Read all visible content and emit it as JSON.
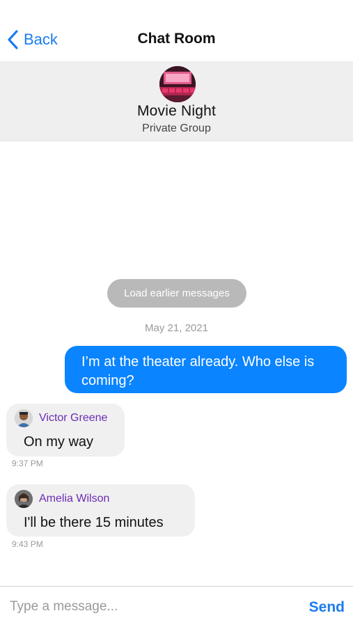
{
  "nav": {
    "back_label": "Back",
    "title": "Chat Room"
  },
  "group": {
    "name": "Movie Night",
    "subtitle": "Private Group",
    "avatar_icon": "movie-theater-avatar"
  },
  "load_earlier_label": "Load earlier messages",
  "date_label": "May 21, 2021",
  "messages": [
    {
      "direction": "outgoing",
      "text": "I’m at the theater already. Who else is coming?"
    },
    {
      "direction": "incoming",
      "sender": "Victor Greene",
      "text": "On my way",
      "time": "9:37 PM"
    },
    {
      "direction": "incoming",
      "sender": "Amelia Wilson",
      "text": "I'll be there 15 minutes",
      "time": "9:43 PM"
    }
  ],
  "composer": {
    "placeholder": "Type a message...",
    "send_label": "Send"
  },
  "colors": {
    "accent": "#1a7cf1",
    "outgoing_bubble": "#0a84ff",
    "incoming_bubble": "#f0f0f0",
    "sender_name": "#6b2bb5",
    "header_bg": "#efefef"
  }
}
